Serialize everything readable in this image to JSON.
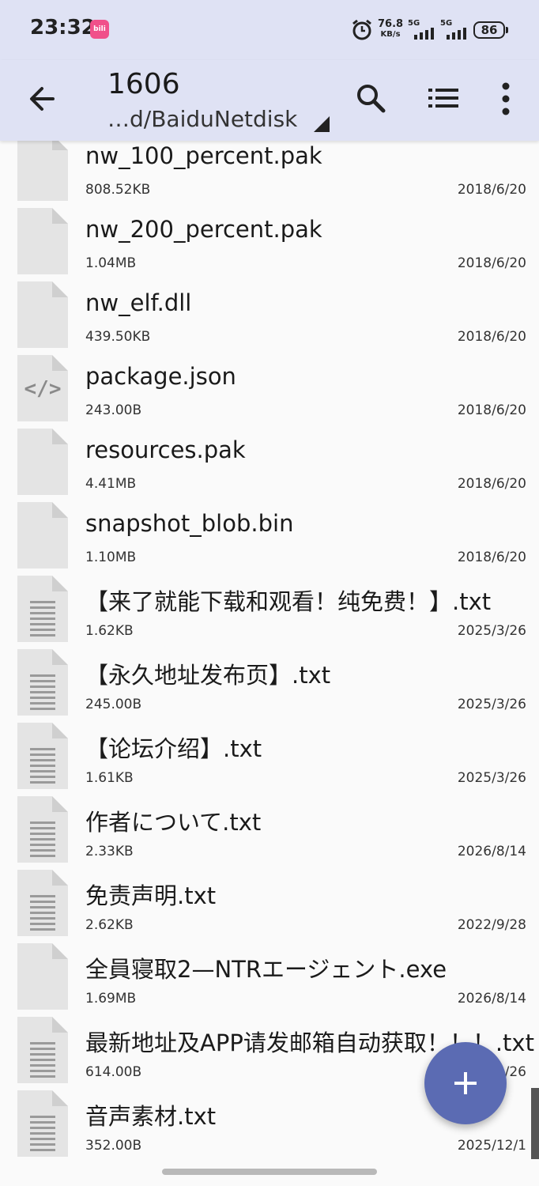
{
  "status": {
    "time": "23:32",
    "app_badge": "bili",
    "net_speed_value": "76.8",
    "net_speed_unit": "KB/s",
    "sim1": "5G",
    "sim2": "5G",
    "battery": "86"
  },
  "header": {
    "title": "1606",
    "path": "…d/BaiduNetdisk"
  },
  "files": [
    {
      "name": "nw_100_percent.pak",
      "size": "808.52KB",
      "date": "2018/6/20",
      "icon": "file-icon"
    },
    {
      "name": "nw_200_percent.pak",
      "size": "1.04MB",
      "date": "2018/6/20",
      "icon": "file-icon"
    },
    {
      "name": "nw_elf.dll",
      "size": "439.50KB",
      "date": "2018/6/20",
      "icon": "file-icon"
    },
    {
      "name": "package.json",
      "size": "243.00B",
      "date": "2018/6/20",
      "icon": "code-file-icon"
    },
    {
      "name": "resources.pak",
      "size": "4.41MB",
      "date": "2018/6/20",
      "icon": "file-icon"
    },
    {
      "name": "snapshot_blob.bin",
      "size": "1.10MB",
      "date": "2018/6/20",
      "icon": "file-icon"
    },
    {
      "name": "【来了就能下载和观看！纯免费！】.txt",
      "size": "1.62KB",
      "date": "2025/3/26",
      "icon": "text-file-icon"
    },
    {
      "name": "【永久地址发布页】.txt",
      "size": "245.00B",
      "date": "2025/3/26",
      "icon": "text-file-icon"
    },
    {
      "name": "【论坛介绍】.txt",
      "size": "1.61KB",
      "date": "2025/3/26",
      "icon": "text-file-icon"
    },
    {
      "name": "作者について.txt",
      "size": "2.33KB",
      "date": "2026/8/14",
      "icon": "text-file-icon"
    },
    {
      "name": "免责声明.txt",
      "size": "2.62KB",
      "date": "2022/9/28",
      "icon": "text-file-icon"
    },
    {
      "name": "全員寝取2—NTRエージェント.exe",
      "size": "1.69MB",
      "date": "2026/8/14",
      "icon": "file-icon"
    },
    {
      "name": "最新地址及APP请发邮箱自动获取！！！.txt",
      "size": "614.00B",
      "date": "/26",
      "icon": "text-file-icon"
    },
    {
      "name": "音声素材.txt",
      "size": "352.00B",
      "date": "2025/12/1",
      "icon": "text-file-icon"
    }
  ],
  "fab": {
    "label": "+"
  },
  "colors": {
    "header_bg": "#dfe2f4",
    "fab": "#5b6bb3",
    "list_bg": "#fafafa"
  }
}
